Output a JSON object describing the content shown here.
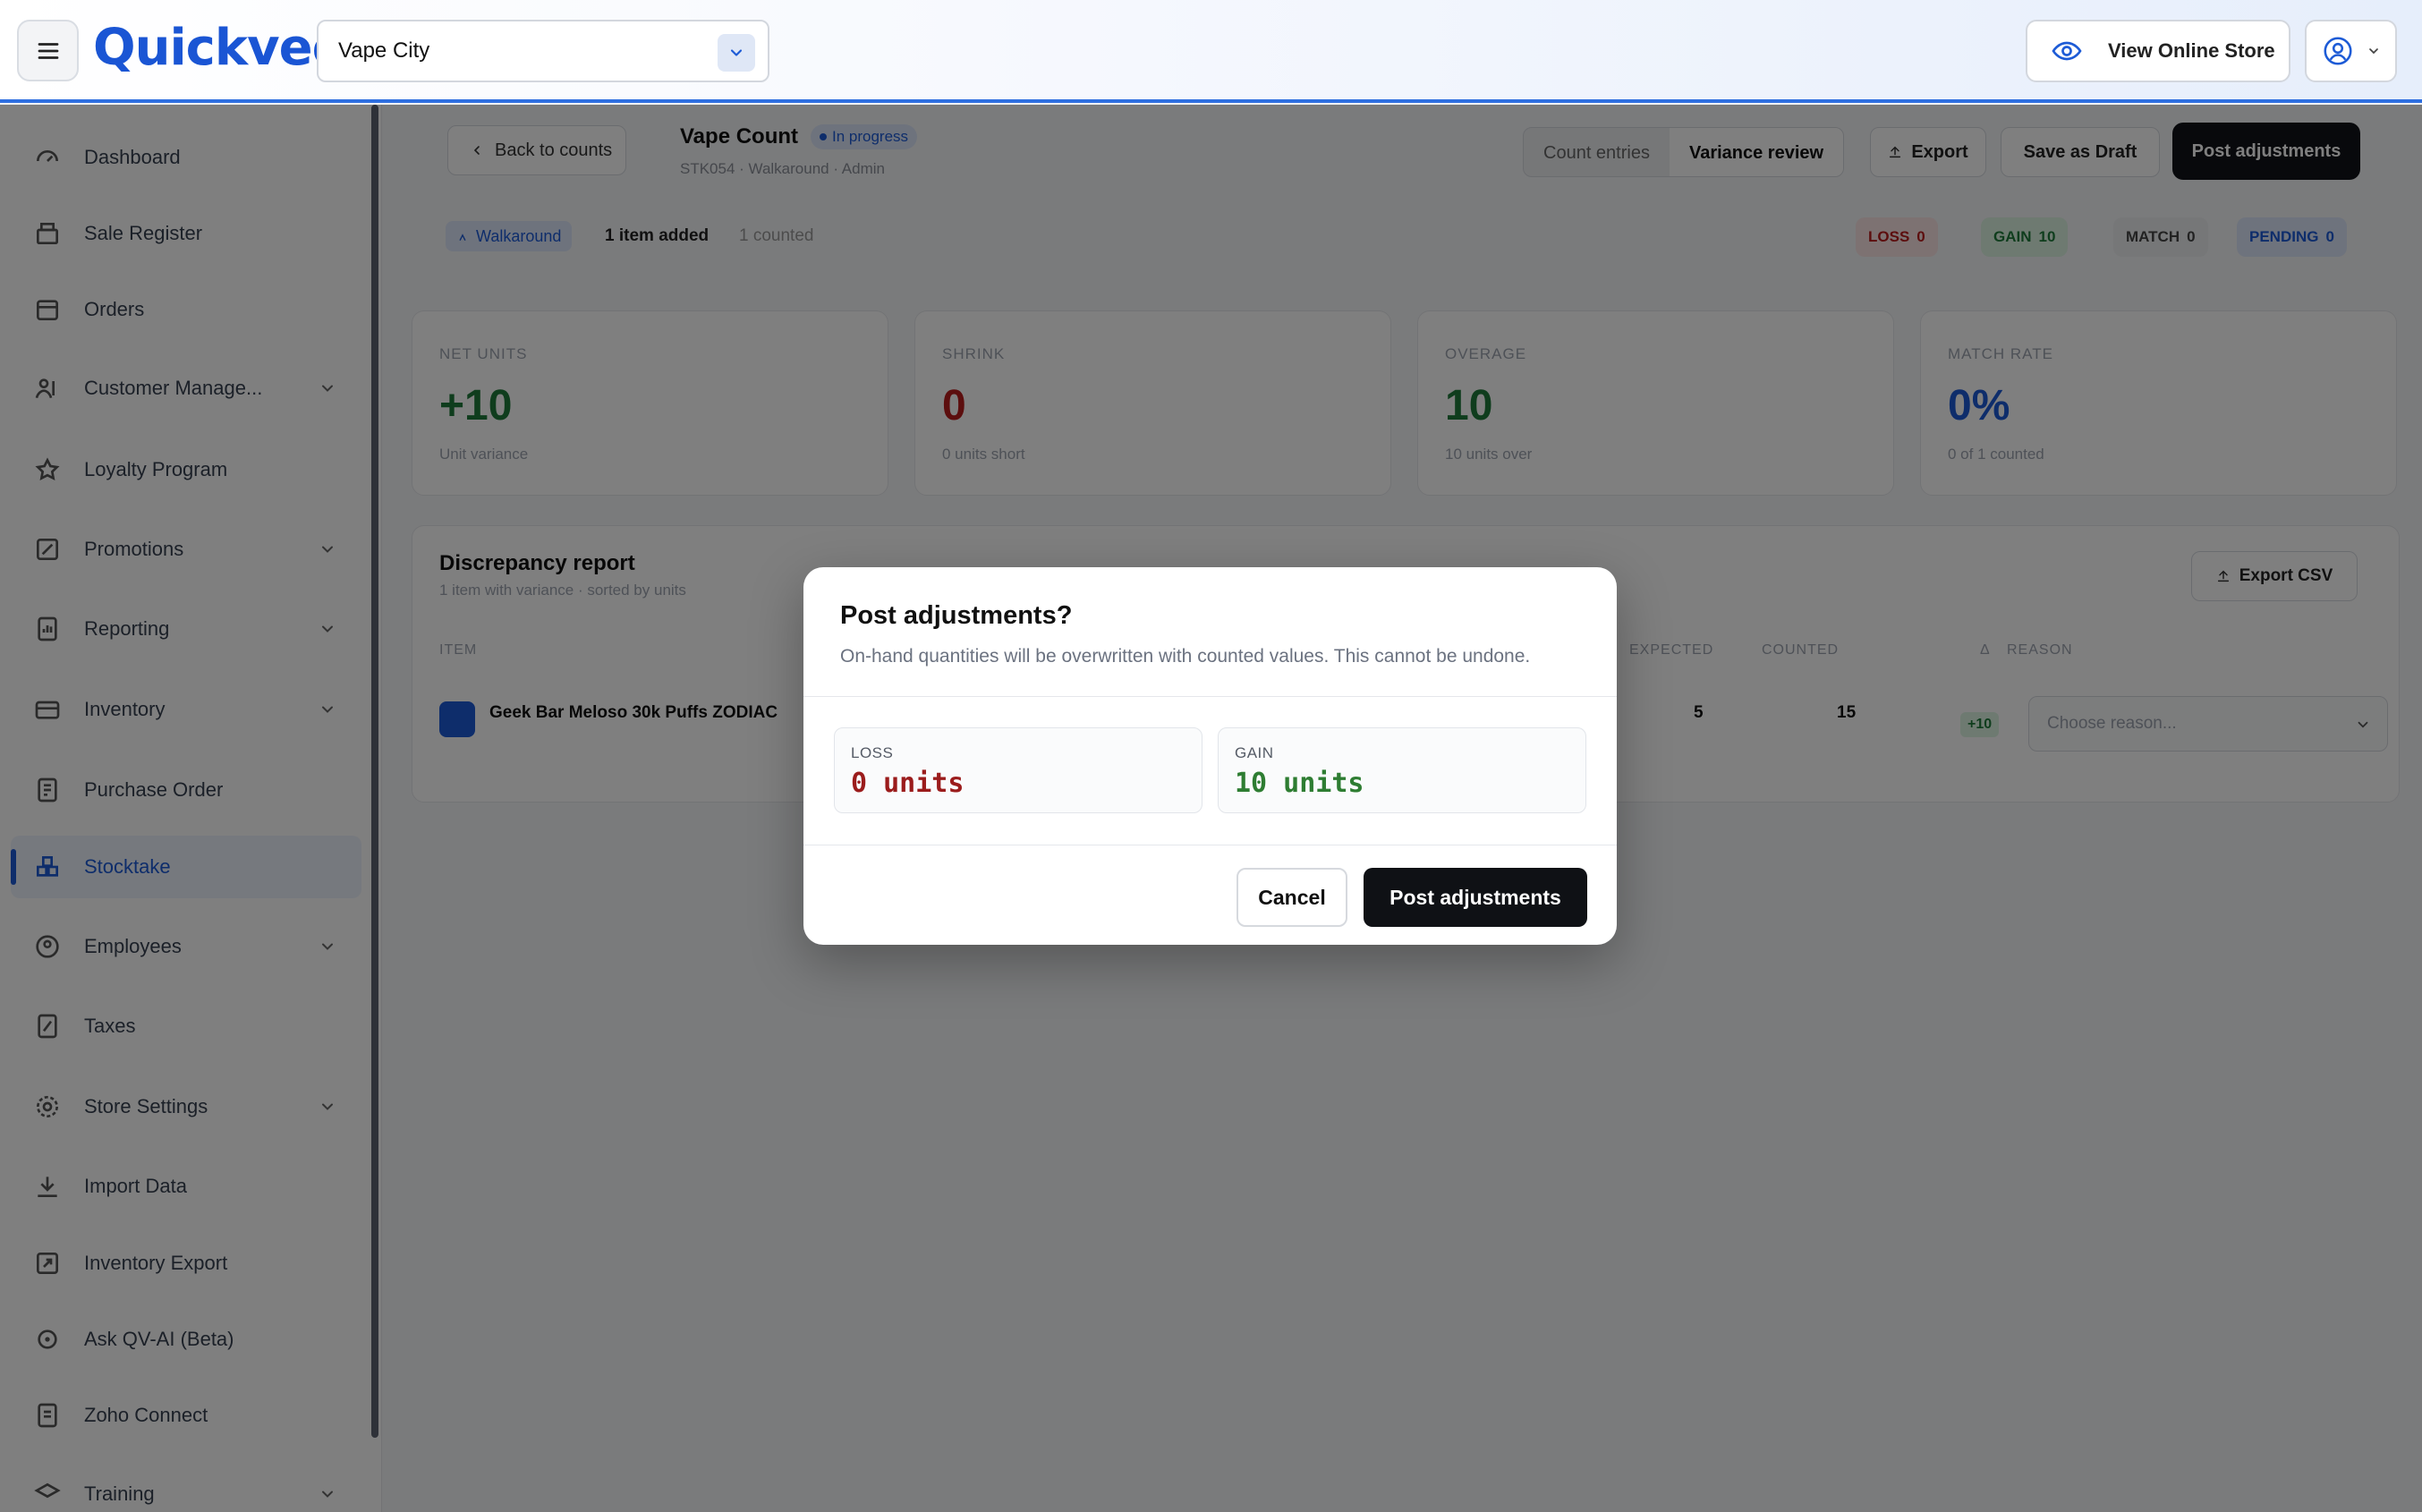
{
  "topbar": {
    "brand": "Quickvee",
    "store_name": "Vape City",
    "view_store_label": "View Online Store"
  },
  "sidebar": {
    "items": [
      {
        "label": "Dashboard",
        "icon": "dashboard-icon",
        "has_submenu": false,
        "active": false
      },
      {
        "label": "Sale Register",
        "icon": "register-icon",
        "has_submenu": false,
        "active": false
      },
      {
        "label": "Orders",
        "icon": "orders-icon",
        "has_submenu": false,
        "active": false
      },
      {
        "label": "Customer Manage...",
        "icon": "customers-icon",
        "has_submenu": true,
        "active": false
      },
      {
        "label": "Loyalty Program",
        "icon": "loyalty-icon",
        "has_submenu": false,
        "active": false
      },
      {
        "label": "Promotions",
        "icon": "promotions-icon",
        "has_submenu": true,
        "active": false
      },
      {
        "label": "Reporting",
        "icon": "reporting-icon",
        "has_submenu": true,
        "active": false
      },
      {
        "label": "Inventory",
        "icon": "inventory-icon",
        "has_submenu": true,
        "active": false
      },
      {
        "label": "Purchase Order",
        "icon": "purchase-order-icon",
        "has_submenu": false,
        "active": false
      },
      {
        "label": "Stocktake",
        "icon": "stocktake-icon",
        "has_submenu": false,
        "active": true
      },
      {
        "label": "Employees",
        "icon": "employees-icon",
        "has_submenu": true,
        "active": false
      },
      {
        "label": "Taxes",
        "icon": "taxes-icon",
        "has_submenu": false,
        "active": false
      },
      {
        "label": "Store Settings",
        "icon": "store-settings-icon",
        "has_submenu": true,
        "active": false
      },
      {
        "label": "Import Data",
        "icon": "import-icon",
        "has_submenu": false,
        "active": false
      },
      {
        "label": "Inventory Export",
        "icon": "export-icon",
        "has_submenu": false,
        "active": false
      },
      {
        "label": "Ask QV-AI (Beta)",
        "icon": "ai-icon",
        "has_submenu": false,
        "active": false
      },
      {
        "label": "Zoho Connect",
        "icon": "zoho-icon",
        "has_submenu": false,
        "active": false
      },
      {
        "label": "Training",
        "icon": "training-icon",
        "has_submenu": true,
        "active": false
      }
    ]
  },
  "header": {
    "back_label": "Back to counts",
    "title": "Vape Count",
    "status": "In progress",
    "meta": "STK054 · Walkaround · Admin",
    "tabs": [
      {
        "label": "Count entries",
        "active": false
      },
      {
        "label": "Variance review",
        "active": true
      }
    ],
    "export_label": "Export",
    "save_draft_label": "Save as Draft",
    "post_label": "Post adjustments",
    "source_chip": "Walkaround",
    "items_added": "1 item added",
    "items_counted": "1 counted",
    "tags": [
      {
        "label": "LOSS",
        "count": "0",
        "color": "#b91c1c",
        "bg": "#fbe4e4"
      },
      {
        "label": "GAIN",
        "count": "10",
        "color": "#1f7a3a",
        "bg": "#dcf5e3"
      },
      {
        "label": "MATCH",
        "count": "0",
        "color": "#444444",
        "bg": "#eceef1"
      },
      {
        "label": "PENDING",
        "count": "0",
        "color": "#1d5bd6",
        "bg": "#dde7fb"
      }
    ]
  },
  "kpis": [
    {
      "label": "NET UNITS",
      "value": "+10",
      "sub": "Unit variance",
      "color": "#1f7a3a"
    },
    {
      "label": "SHRINK",
      "value": "0",
      "sub": "0 units short",
      "color": "#b91c1c"
    },
    {
      "label": "OVERAGE",
      "value": "10",
      "sub": "10 units over",
      "color": "#1f7a3a"
    },
    {
      "label": "MATCH RATE",
      "value": "0%",
      "sub": "0 of 1 counted",
      "color": "#1d5bd6"
    }
  ],
  "report": {
    "title": "Discrepancy report",
    "subtitle": "1 item with variance · sorted by units",
    "export_csv": "Export CSV",
    "columns": {
      "item": "ITEM",
      "expected": "EXPECTED",
      "counted": "COUNTED",
      "diff": "Δ",
      "reason": "REASON"
    },
    "rows": [
      {
        "item": "Geek Bar Meloso 30k Puffs ZODIAC",
        "expected": "5",
        "counted": "15",
        "diff": "+10",
        "reason_placeholder": "Choose reason..."
      }
    ]
  },
  "modal": {
    "title": "Post adjustments?",
    "description": "On-hand quantities will be overwritten with counted values. This cannot be undone.",
    "loss_label": "LOSS",
    "loss_value": "0 units",
    "gain_label": "GAIN",
    "gain_value": "10 units",
    "cancel_label": "Cancel",
    "confirm_label": "Post adjustments"
  },
  "colors": {
    "brand": "#1a55d4",
    "loss": "#9b1c1c",
    "gain": "#2e7d32",
    "dark_button": "#0f1115"
  }
}
